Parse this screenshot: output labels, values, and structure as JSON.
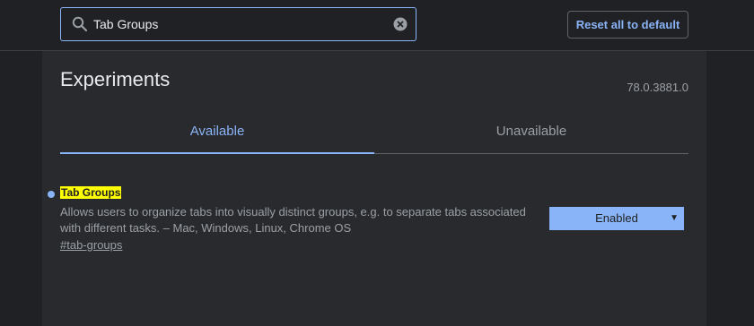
{
  "search": {
    "value": "Tab Groups",
    "icon": "search-icon",
    "clear_icon": "clear-icon"
  },
  "toolbar": {
    "reset_label": "Reset all to default"
  },
  "header": {
    "title": "Experiments",
    "version": "78.0.3881.0"
  },
  "tabs": [
    {
      "label": "Available",
      "selected": true
    },
    {
      "label": "Unavailable",
      "selected": false
    }
  ],
  "experiment": {
    "name": "Tab Groups",
    "description": "Allows users to organize tabs into visually distinct groups, e.g. to separate tabs associated with different tasks. – Mac, Windows, Linux, Chrome OS",
    "link": "#tab-groups",
    "state": "Enabled"
  },
  "colors": {
    "accent": "#8ab4f8",
    "highlight": "#ffff00",
    "background": "#202124",
    "panel": "#292a2d"
  }
}
